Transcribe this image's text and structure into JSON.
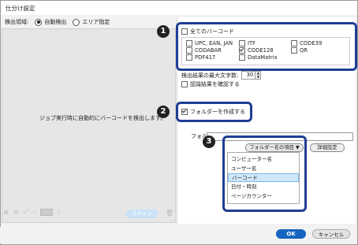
{
  "window": {
    "title": "仕分け設定"
  },
  "detection": {
    "label": "検出領域:",
    "auto": "自動検出",
    "area": "エリア指定"
  },
  "preview": {
    "message": "ジョブ実行時に自動的にバーコードを検出します。",
    "scan_label": "スキャン"
  },
  "barcodes": {
    "select_all": "全てのバーコード",
    "items": [
      {
        "label": "UPC, EAN, JAN",
        "checked": false
      },
      {
        "label": "ITF",
        "checked": false
      },
      {
        "label": "CODE39",
        "checked": false
      },
      {
        "label": "CODABAR",
        "checked": false
      },
      {
        "label": "CODE128",
        "checked": true
      },
      {
        "label": "QR",
        "checked": false
      },
      {
        "label": "PDF417",
        "checked": false
      },
      {
        "label": "DataMatrix",
        "checked": false
      }
    ]
  },
  "settings": {
    "max_chars_label": "検出結果の最大文字数:",
    "max_chars_value": "30",
    "confirm_label": "認識結果を確認する",
    "create_folder_label": "フォルダーを作成する",
    "folder_name_label": "フォルダー名:",
    "folder_item_button": "フォルダー名の項目 ▼",
    "detail_button": "詳細設定"
  },
  "dropdown": {
    "items": [
      "コンピューター名",
      "ユーザー名",
      "バーコード",
      "日付・時刻",
      "ページカウンター"
    ],
    "highlighted": "バーコード"
  },
  "callouts": [
    "1",
    "2",
    "3"
  ],
  "footer": {
    "ok": "OK",
    "cancel": "キャンセル"
  }
}
